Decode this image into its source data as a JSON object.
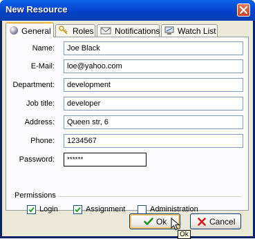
{
  "window": {
    "title": "New Resource"
  },
  "tabs": [
    {
      "label": "General",
      "icon": "sphere-icon",
      "active": true
    },
    {
      "label": "Roles",
      "icon": "keys-icon",
      "active": false
    },
    {
      "label": "Notifications",
      "icon": "envelope-icon",
      "active": false
    },
    {
      "label": "Watch List",
      "icon": "monitor-icon",
      "active": false
    }
  ],
  "form": {
    "name": {
      "label": "Name:",
      "value": "Joe Black"
    },
    "email": {
      "label": "E-Mail:",
      "value": "loe@yahoo.com"
    },
    "department": {
      "label": "Department:",
      "value": "development"
    },
    "job_title": {
      "label": "Job title:",
      "value": "developer"
    },
    "address": {
      "label": "Address:",
      "value": "Queen str, 6"
    },
    "phone": {
      "label": "Phone:",
      "value": "1234567"
    },
    "password": {
      "label": "Password:",
      "value": "******"
    }
  },
  "permissions": {
    "title": "Permissions",
    "items": [
      {
        "label": "Login",
        "checked": true
      },
      {
        "label": "Assignment",
        "checked": true
      },
      {
        "label": "Administration",
        "checked": false
      }
    ]
  },
  "buttons": {
    "ok": "Ok",
    "cancel": "Cancel"
  },
  "tooltip": "Ok",
  "colors": {
    "titlebar": "#0a4ed8",
    "dialog_bg": "#ece9d8",
    "active_tab_accent": "#f2b23b",
    "ok_check": "#1f8f1f",
    "cancel_x": "#d11a1a"
  }
}
